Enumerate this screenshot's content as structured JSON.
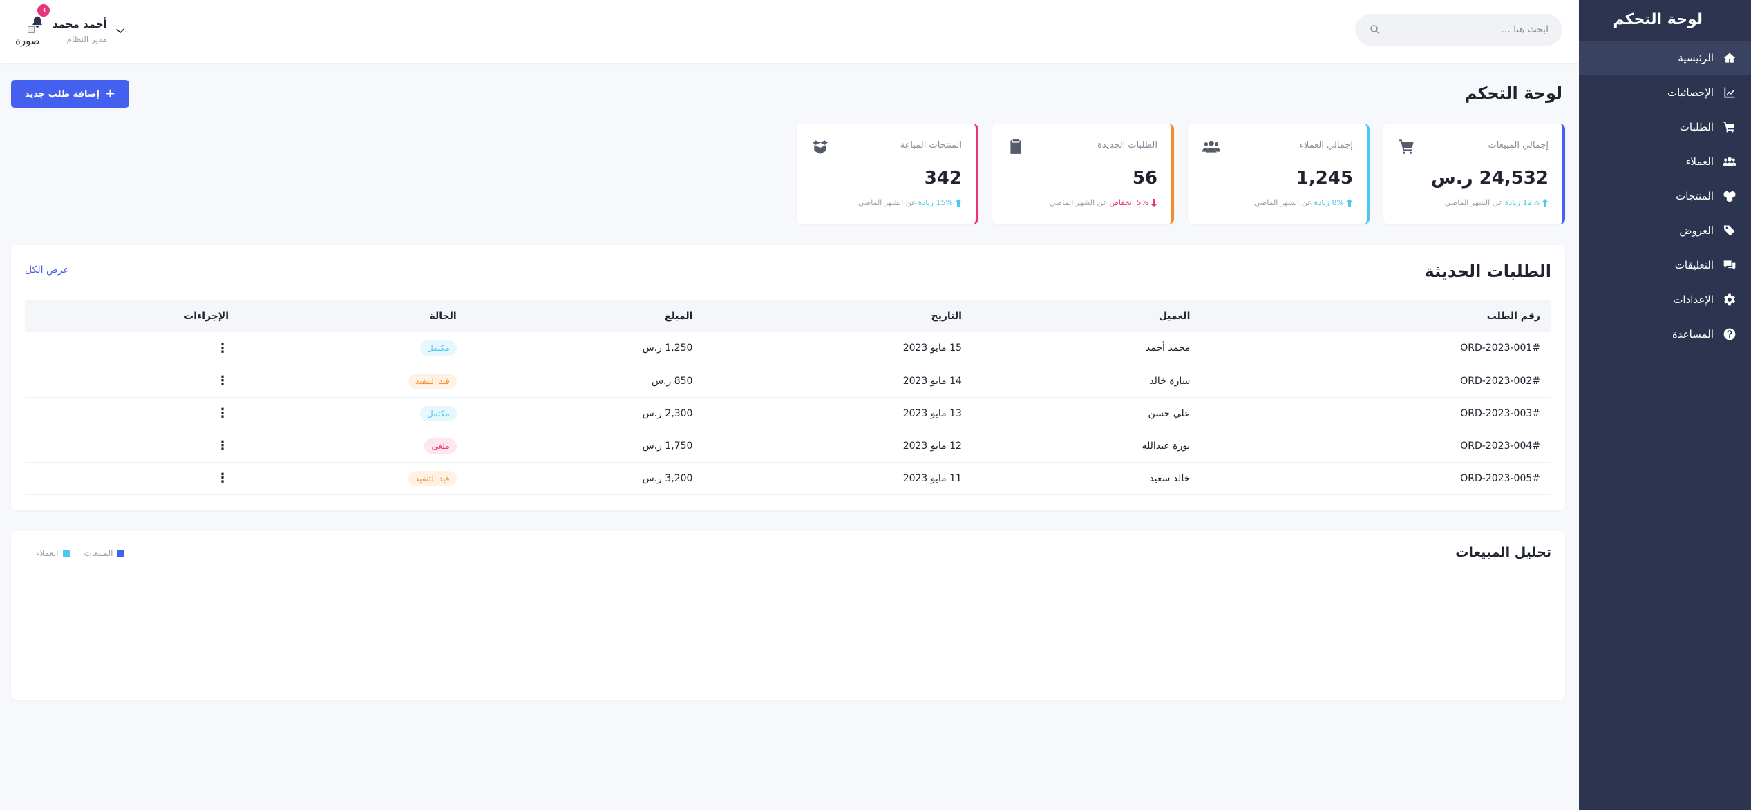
{
  "sidebar": {
    "brand": "لوحة التحكم",
    "items": [
      {
        "label": "الرئيسية",
        "icon": "home-icon",
        "active": true
      },
      {
        "label": "الإحصائيات",
        "icon": "chart-line-icon"
      },
      {
        "label": "الطلبات",
        "icon": "shopping-cart-icon"
      },
      {
        "label": "العملاء",
        "icon": "users-icon"
      },
      {
        "label": "المنتجات",
        "icon": "boxes-icon"
      },
      {
        "label": "العروض",
        "icon": "tags-icon"
      },
      {
        "label": "التعليقات",
        "icon": "comments-icon"
      },
      {
        "label": "الإعدادات",
        "icon": "gear-icon"
      },
      {
        "label": "المساعدة",
        "icon": "question-circle-icon"
      }
    ]
  },
  "topbar": {
    "search_placeholder": "ابحث هنا ...",
    "notifications_count": "3",
    "avatar_alt": "صورة",
    "user_name": "أحمد محمد",
    "user_role": "مدير النظام"
  },
  "main": {
    "title": "لوحة التحكم",
    "add_button": "إضافة طلب جديد"
  },
  "stats": [
    {
      "label": "إجمالي المبيعات",
      "value": "24,532 ر.س",
      "trend": "12% زيادة",
      "suffix": "عن الشهر الماضي",
      "direction": "up",
      "accent": "#4361ee",
      "icon": "shopping-cart-icon"
    },
    {
      "label": "إجمالي العملاء",
      "value": "1,245",
      "trend": "8% زيادة",
      "suffix": "عن الشهر الماضي",
      "direction": "up",
      "accent": "#4cc9f0",
      "icon": "users-icon"
    },
    {
      "label": "الطلبات الجديدة",
      "value": "56",
      "trend": "5% انخفاض",
      "suffix": "عن الشهر الماضي",
      "direction": "down",
      "accent": "#f28b2b",
      "icon": "clipboard-icon"
    },
    {
      "label": "المنتجات المباعة",
      "value": "342",
      "trend": "15% زيادة",
      "suffix": "عن الشهر الماضي",
      "direction": "up",
      "accent": "#e6337a",
      "icon": "box-open-icon"
    }
  ],
  "orders": {
    "title": "الطلبات الحديثة",
    "view_all": "عرض الكل",
    "headers": [
      "رقم الطلب",
      "العميل",
      "التاريخ",
      "المبلغ",
      "الحالة",
      "الإجراءات"
    ],
    "rows": [
      {
        "id": "#ORD-2023-001",
        "customer": "محمد أحمد",
        "date": "15 مايو 2023",
        "amount": "1,250 ر.س",
        "status": "مكتمل",
        "status_type": "done"
      },
      {
        "id": "#ORD-2023-002",
        "customer": "سارة خالد",
        "date": "14 مايو 2023",
        "amount": "850 ر.س",
        "status": "قيد التنفيذ",
        "status_type": "pending"
      },
      {
        "id": "#ORD-2023-003",
        "customer": "علي حسن",
        "date": "13 مايو 2023",
        "amount": "2,300 ر.س",
        "status": "مكتمل",
        "status_type": "done"
      },
      {
        "id": "#ORD-2023-004",
        "customer": "نورة عبدالله",
        "date": "12 مايو 2023",
        "amount": "1,750 ر.س",
        "status": "ملغى",
        "status_type": "cancel"
      },
      {
        "id": "#ORD-2023-005",
        "customer": "خالد سعيد",
        "date": "11 مايو 2023",
        "amount": "3,200 ر.س",
        "status": "قيد التنفيذ",
        "status_type": "pending"
      }
    ],
    "actions_glyph": "⋮"
  },
  "analysis": {
    "title": "تحليل المبيعات",
    "legend": [
      {
        "label": "المبيعات",
        "color": "#4361ee"
      },
      {
        "label": "العملاء",
        "color": "#4cc9f0"
      }
    ]
  }
}
